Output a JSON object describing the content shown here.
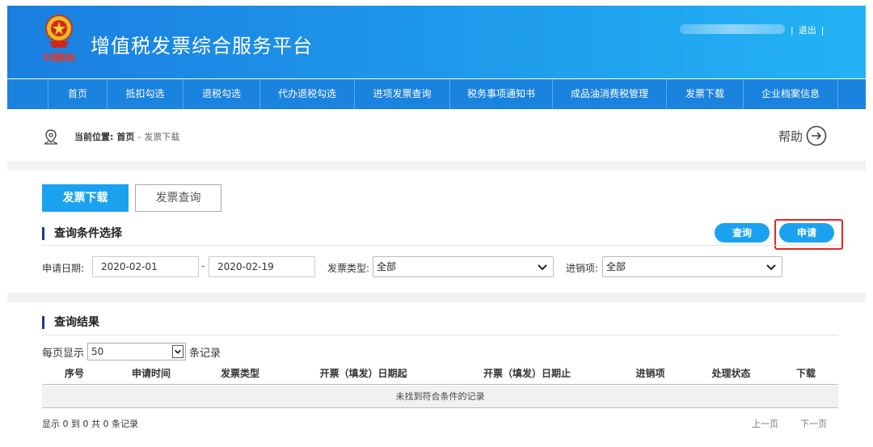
{
  "header": {
    "site_title": "增值税发票综合服务平台",
    "emblem_text": "中国税务",
    "logout_label": "退出",
    "separator": "|"
  },
  "nav": {
    "items": [
      {
        "label": "首页"
      },
      {
        "label": "抵扣勾选"
      },
      {
        "label": "退税勾选"
      },
      {
        "label": "代办退税勾选"
      },
      {
        "label": "进项发票查询"
      },
      {
        "label": "税务事项通知书"
      },
      {
        "label": "成品油消费税管理"
      },
      {
        "label": "发票下载"
      },
      {
        "label": "企业档案信息"
      }
    ]
  },
  "breadcrumb": {
    "prefix": "当前位置:",
    "home": "首页",
    "separator": "-",
    "current": "发票下载"
  },
  "help_label": "帮助",
  "tabs": [
    {
      "label": "发票下载",
      "active": true
    },
    {
      "label": "发票查询",
      "active": false
    }
  ],
  "query_section": {
    "title": "查询条件选择",
    "query_button": "查询",
    "apply_button": "申请",
    "date_label": "申请日期:",
    "date_from": "2020-02-01",
    "date_separator": "-",
    "date_to": "2020-02-19",
    "invoice_type_label": "发票类型:",
    "invoice_type_value": "全部",
    "input_item_label": "进销项:",
    "input_item_value": "全部"
  },
  "results_section": {
    "title": "查询结果",
    "per_page_prefix": "每页显示",
    "per_page_value": "50",
    "per_page_suffix": "条记录",
    "columns": [
      "序号",
      "申请时间",
      "发票类型",
      "开票（填发）日期起",
      "开票（填发）日期止",
      "进销项",
      "处理状态",
      "下载"
    ],
    "empty_message": "未找到符合条件的记录",
    "info_text": "显示 0 到 0 共 0 条记录",
    "prev_page": "上一页",
    "next_page": "下一页"
  },
  "colors": {
    "header_start": "#1a7fe0",
    "header_end": "#23b3f5",
    "nav_bg": "#1a82df",
    "accent": "#1aa2f0",
    "highlight": "#e8261c"
  }
}
